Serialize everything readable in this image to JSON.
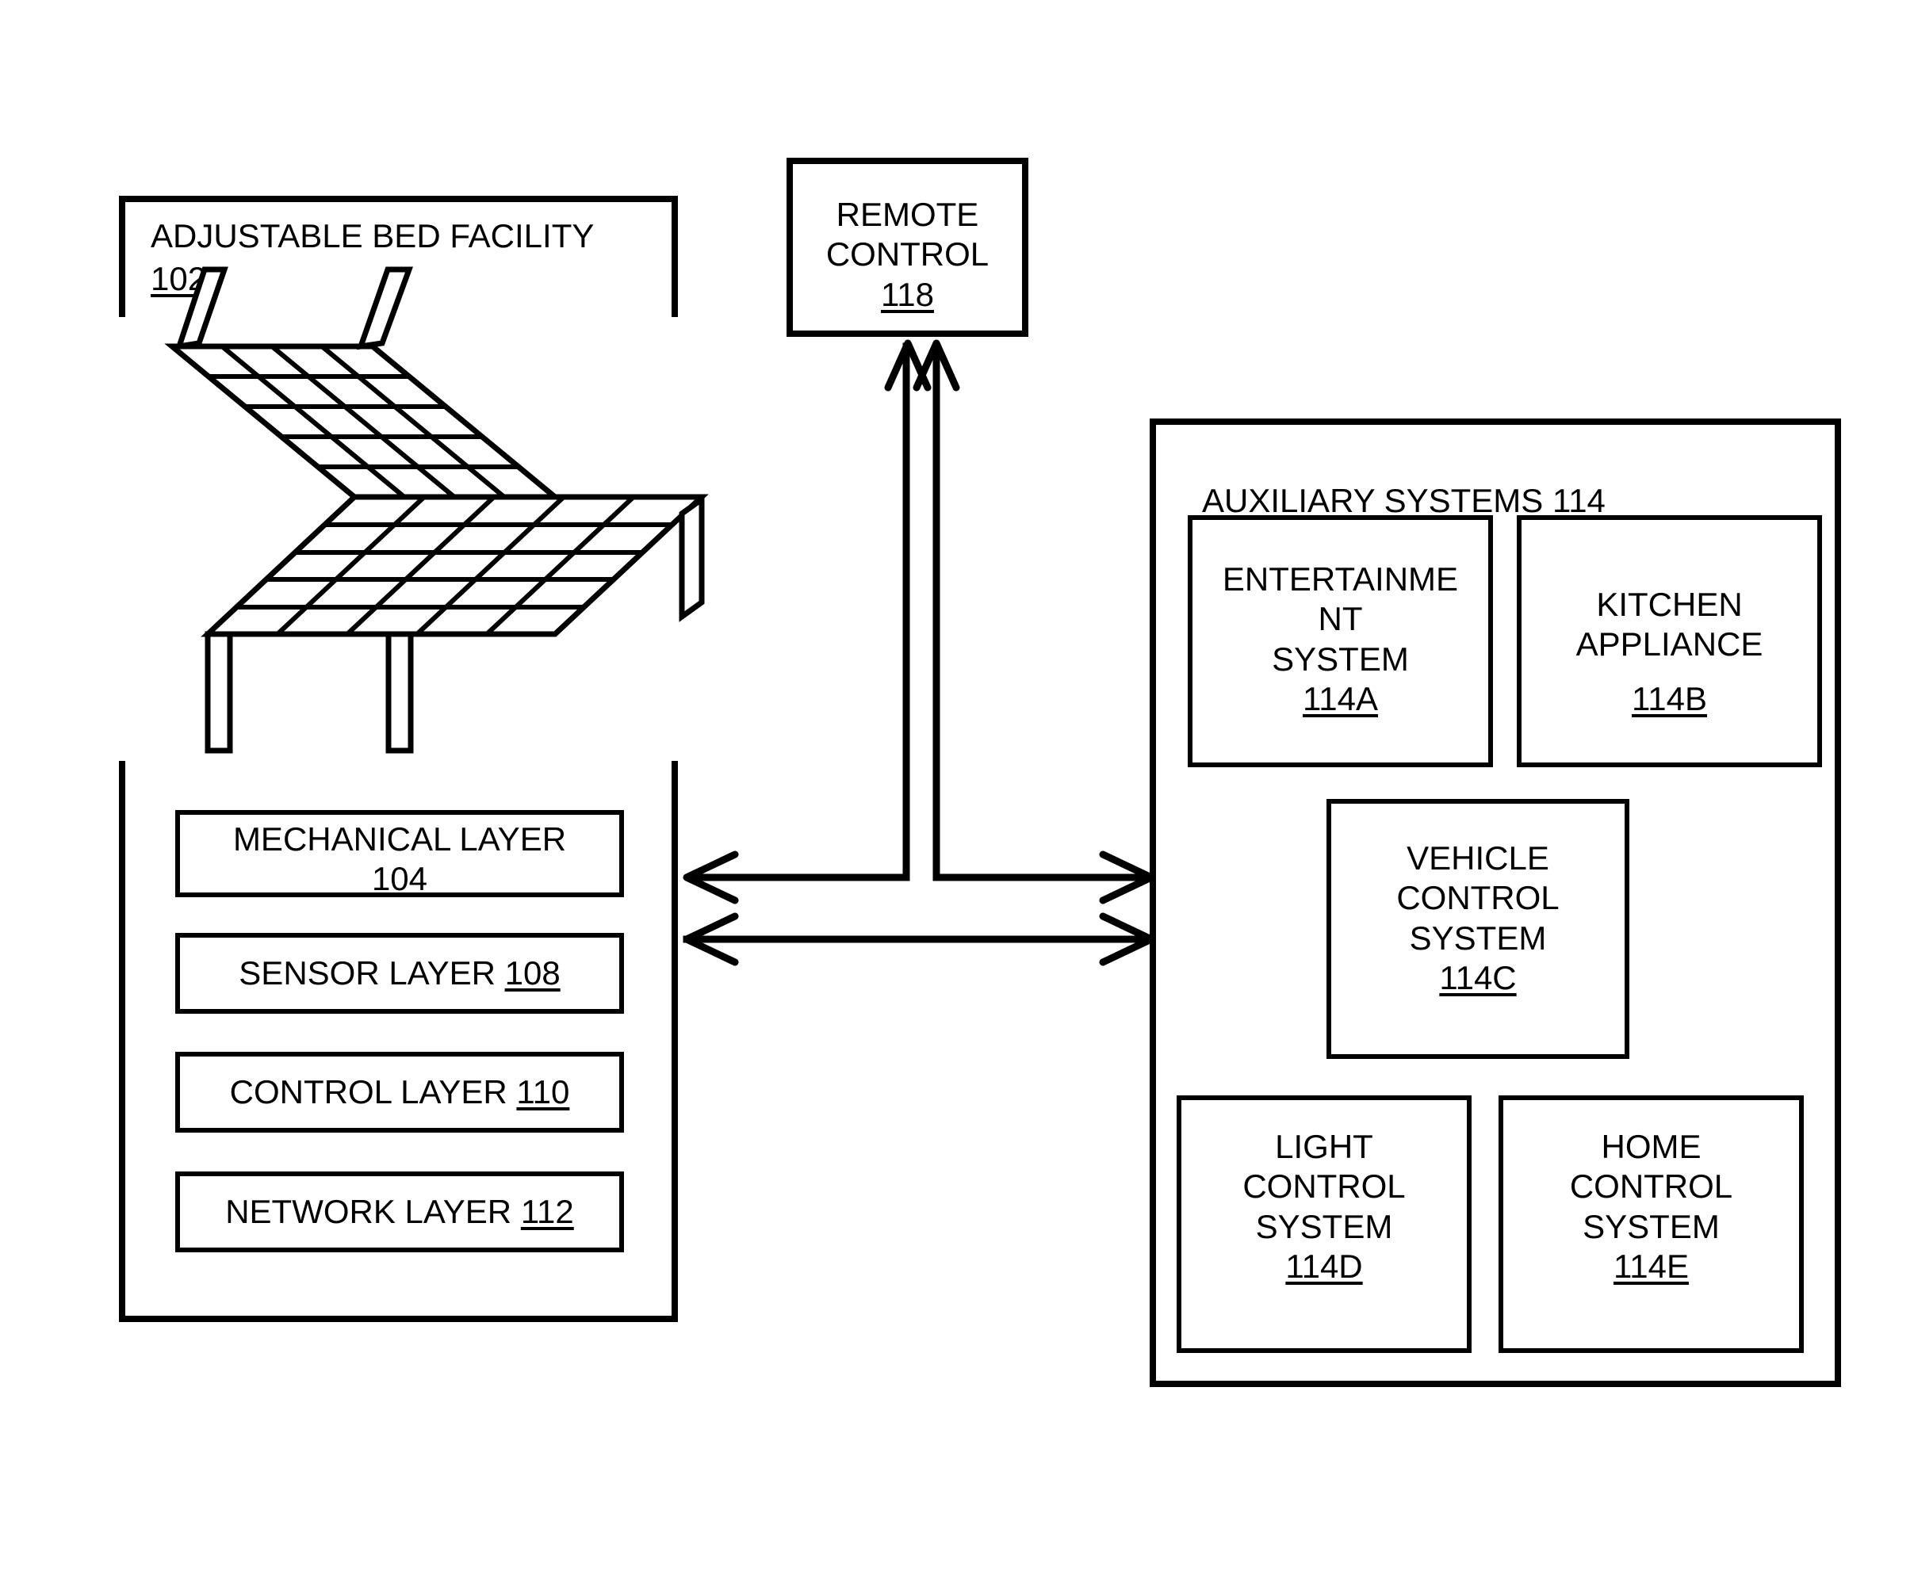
{
  "figure": {
    "type": "patent-block-diagram",
    "background_color": "#ffffff",
    "line_color": "#000000"
  },
  "bed_facility": {
    "title": "ADJUSTABLE BED FACILITY",
    "ref": "102",
    "illustration_name": "adjustable-bed-grid-frame",
    "layers": [
      {
        "name": "mechanical-layer",
        "label": "MECHANICAL LAYER",
        "ref": "104",
        "two_line": true
      },
      {
        "name": "sensor-layer",
        "label": "SENSOR LAYER",
        "ref": "108",
        "two_line": false
      },
      {
        "name": "control-layer",
        "label": "CONTROL LAYER",
        "ref": "110",
        "two_line": false
      },
      {
        "name": "network-layer",
        "label": "NETWORK LAYER",
        "ref": "112",
        "two_line": false
      }
    ]
  },
  "remote_control": {
    "line1": "REMOTE",
    "line2": "CONTROL",
    "ref": "118"
  },
  "auxiliary_systems": {
    "title": "AUXILIARY SYSTEMS",
    "ref": "114",
    "items": [
      {
        "name": "entertainment-system",
        "lines": [
          "ENTERTAINME",
          "NT",
          "SYSTEM"
        ],
        "ref": "114A"
      },
      {
        "name": "kitchen-appliance",
        "lines": [
          "KITCHEN",
          "APPLIANCE",
          ""
        ],
        "ref": "114B"
      },
      {
        "name": "vehicle-control-system",
        "lines": [
          "VEHICLE",
          "CONTROL",
          "SYSTEM"
        ],
        "ref": "114C"
      },
      {
        "name": "light-control-system",
        "lines": [
          "LIGHT",
          "CONTROL",
          "SYSTEM"
        ],
        "ref": "114D"
      },
      {
        "name": "home-control-system",
        "lines": [
          "HOME",
          "CONTROL",
          "SYSTEM"
        ],
        "ref": "114E"
      }
    ]
  },
  "connections": [
    {
      "name": "remote-to-bed-arrow",
      "from": "REMOTE CONTROL 118",
      "to": "ADJUSTABLE BED FACILITY 102",
      "direction": "one-way"
    },
    {
      "name": "remote-to-auxiliary-arrow",
      "from": "REMOTE CONTROL 118",
      "to": "AUXILIARY SYSTEMS 114",
      "direction": "one-way"
    },
    {
      "name": "bed-to-auxiliary-arrow",
      "from": "ADJUSTABLE BED FACILITY 102",
      "to": "AUXILIARY SYSTEMS 114",
      "direction": "two-way"
    }
  ]
}
